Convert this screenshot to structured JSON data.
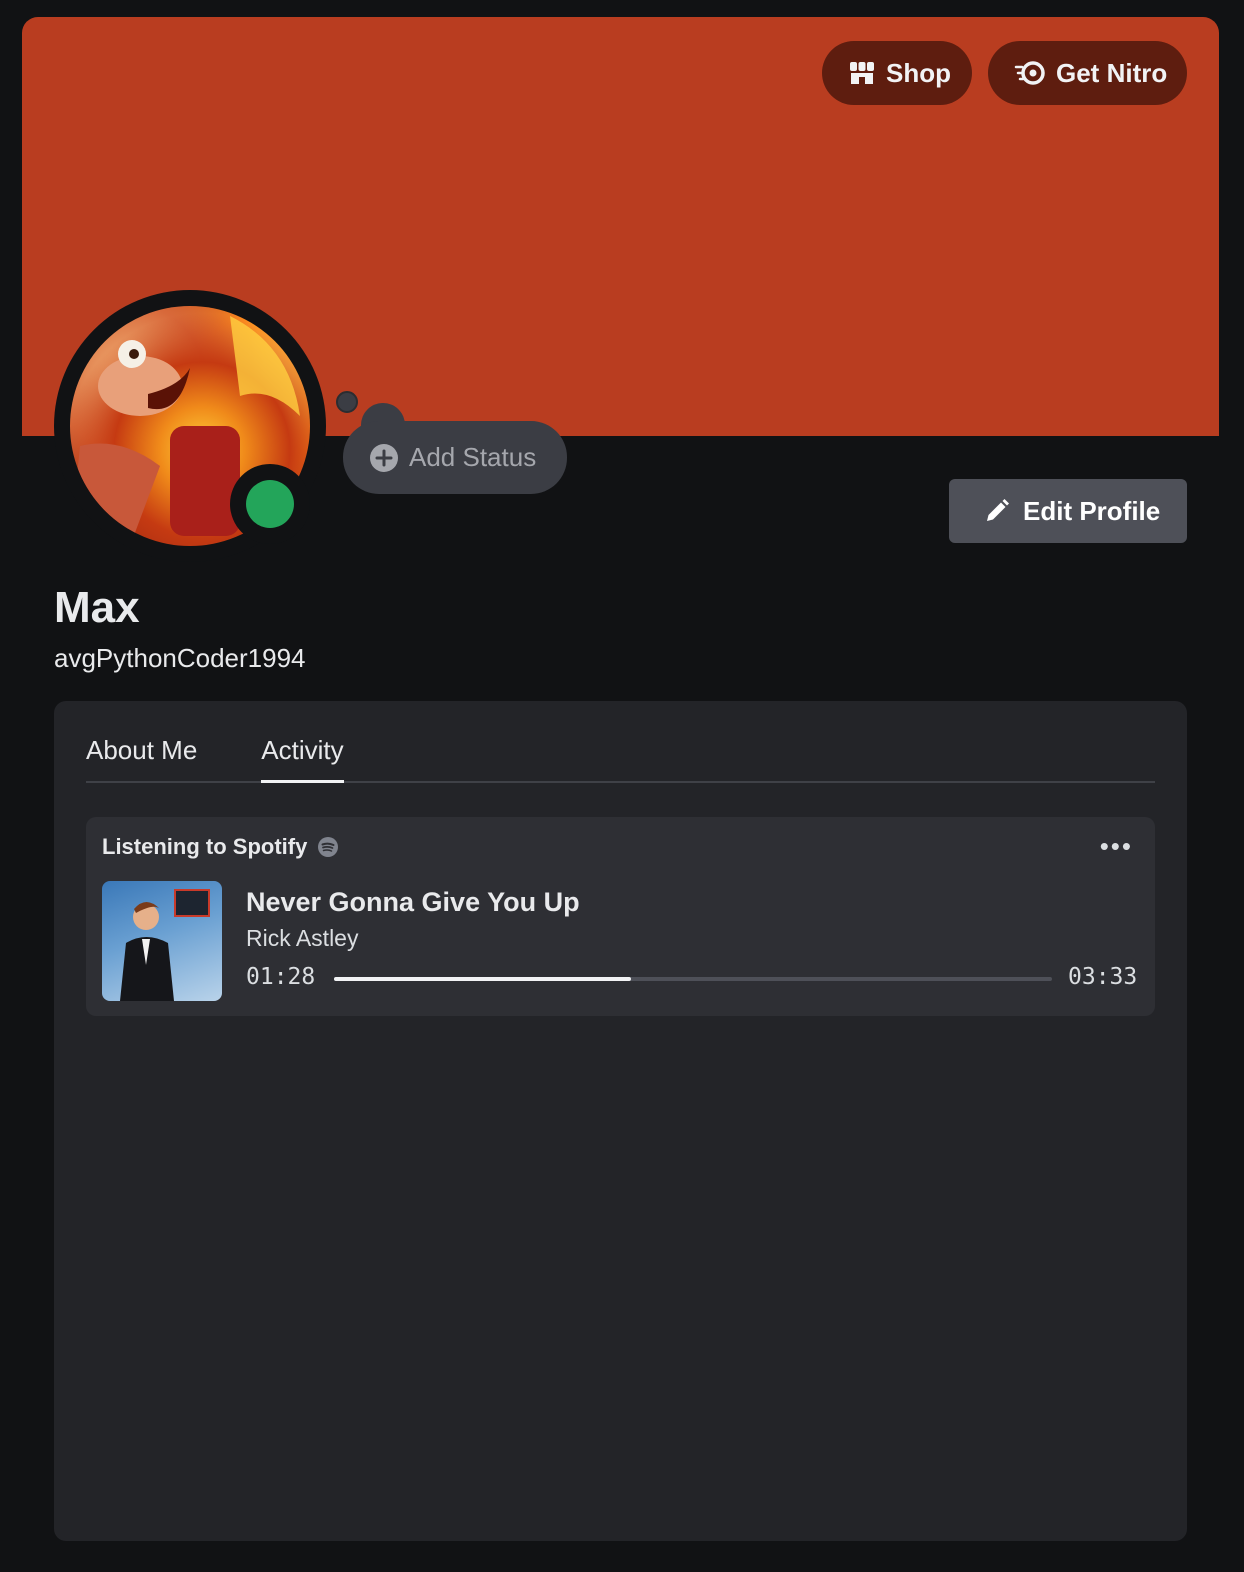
{
  "header": {
    "shop_label": "Shop",
    "nitro_label": "Get Nitro",
    "banner_color": "#b93d20"
  },
  "profile": {
    "display_name": "Max",
    "username": "avgPythonCoder1994",
    "status_color": "#23a55a",
    "add_status_label": "Add Status",
    "edit_profile_label": "Edit Profile"
  },
  "tabs": [
    {
      "label": "About Me",
      "active": false
    },
    {
      "label": "Activity",
      "active": true
    }
  ],
  "activity": {
    "header": "Listening to Spotify",
    "song": "Never Gonna Give You Up",
    "artist": "Rick Astley",
    "elapsed": "01:28",
    "duration": "03:33",
    "progress": 0.413
  },
  "icons": {
    "shop": "shop-icon",
    "nitro": "nitro-icon",
    "add_status": "plus-circle-icon",
    "edit": "pencil-icon",
    "spotify": "spotify-icon",
    "more": "more-icon"
  }
}
